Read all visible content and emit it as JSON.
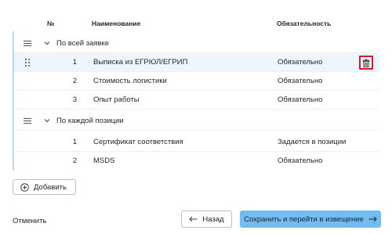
{
  "table": {
    "columns": {
      "num": "№",
      "name": "Наименование",
      "requirement": "Обязательность"
    },
    "groups": [
      {
        "label": "По всей заявке",
        "rows": [
          {
            "num": "1",
            "name": "Выписка из ЕГРЮЛ/ЕГРИП",
            "requirement": "Обязательно"
          },
          {
            "num": "2",
            "name": "Стоимость логистики",
            "requirement": "Обязательно"
          },
          {
            "num": "3",
            "name": "Опыт работы",
            "requirement": "Обязательно"
          }
        ]
      },
      {
        "label": "По каждой позиции",
        "rows": [
          {
            "num": "1",
            "name": "Сертификат соответствия",
            "requirement": "Задается в позиции"
          },
          {
            "num": "2",
            "name": "MSDS",
            "requirement": "Обязательно"
          }
        ]
      }
    ]
  },
  "buttons": {
    "add": "Добавить",
    "cancel": "Отменить",
    "back": "Назад",
    "save": "Сохранить и перейти в извещение"
  },
  "icons": {
    "list": "list-icon",
    "chevron": "chevron-down-icon",
    "drag": "drag-handle-icon",
    "trash": "trash-icon",
    "plus": "plus-circle-icon",
    "arrow_left": "arrow-left-icon",
    "arrow_right": "arrow-right-icon"
  },
  "colors": {
    "primary": "#72bcf2",
    "delete_highlight": "#d9162a",
    "row_hover": "#eef5fc",
    "group_border": "#bcd6f2"
  }
}
